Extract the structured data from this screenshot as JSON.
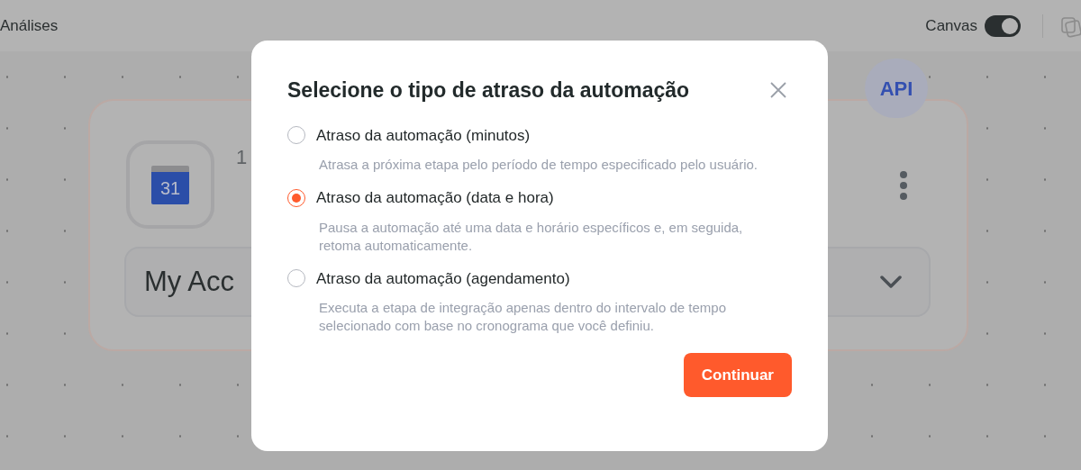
{
  "topbar": {
    "tab_label": "Análises",
    "canvas_toggle": {
      "label": "Canvas",
      "on": true
    }
  },
  "node": {
    "badge": "API",
    "step_number": "1",
    "calendar_day": "31",
    "account_select": {
      "value": "My Acc"
    }
  },
  "dialog": {
    "title": "Selecione o tipo de atraso da automação",
    "options": [
      {
        "label": "Atraso da automação (minutos)",
        "description": "Atrasa a próxima etapa pelo período de tempo especificado pelo usuário.",
        "selected": false
      },
      {
        "label": "Atraso da automação (data e hora)",
        "description": "Pausa a automação até uma data e horário específicos e, em seguida, retoma automaticamente.",
        "selected": true
      },
      {
        "label": "Atraso da automação (agendamento)",
        "description": "Executa a etapa de integração apenas dentro do intervalo de tempo selecionado com base no cronograma que você definiu.",
        "selected": false
      }
    ],
    "continue_button": "Continuar"
  }
}
